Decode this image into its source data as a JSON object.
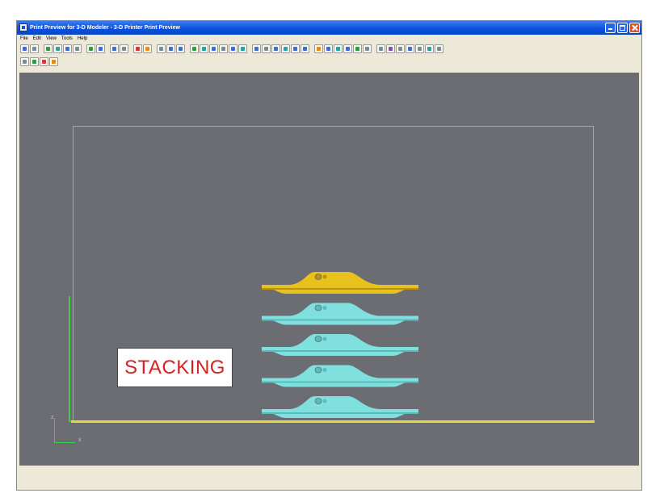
{
  "window": {
    "title": "Print Preview for 3-D Modeler - 3-D Printer Print Preview"
  },
  "menu": [
    "File",
    "Edit",
    "View",
    "Tools",
    "Help"
  ],
  "toolbar": {
    "row1_groups": [
      [
        "blue",
        "gray"
      ],
      [
        "green",
        "teal",
        "blue",
        "gray"
      ],
      [
        "green",
        "blue"
      ],
      [
        "blue",
        "gray"
      ],
      [
        "red",
        "orange"
      ],
      [
        "gray",
        "blue",
        "blue"
      ],
      [
        "green",
        "teal",
        "blue",
        "gray",
        "blue",
        "teal"
      ],
      [
        "blue",
        "gray",
        "blue",
        "teal",
        "blue",
        "blue"
      ],
      [
        "orange",
        "blue",
        "teal",
        "blue",
        "green",
        "gray"
      ],
      [
        "gray",
        "purple",
        "gray",
        "blue",
        "gray",
        "teal",
        "gray"
      ]
    ],
    "row2_groups": [
      [
        "gray",
        "green",
        "red",
        "orange"
      ]
    ]
  },
  "viewport": {
    "background": "#6c6d72",
    "stack_label": "STACKING",
    "triad": {
      "z": "z",
      "x": "x"
    },
    "parts": [
      {
        "color": "#e8c21c",
        "shade": "#b8940e"
      },
      {
        "color": "#7fe0de",
        "shade": "#5cbcbc"
      },
      {
        "color": "#7fe0de",
        "shade": "#5cbcbc"
      },
      {
        "color": "#7fe0de",
        "shade": "#5cbcbc"
      },
      {
        "color": "#7fe0de",
        "shade": "#5cbcbc"
      }
    ]
  }
}
